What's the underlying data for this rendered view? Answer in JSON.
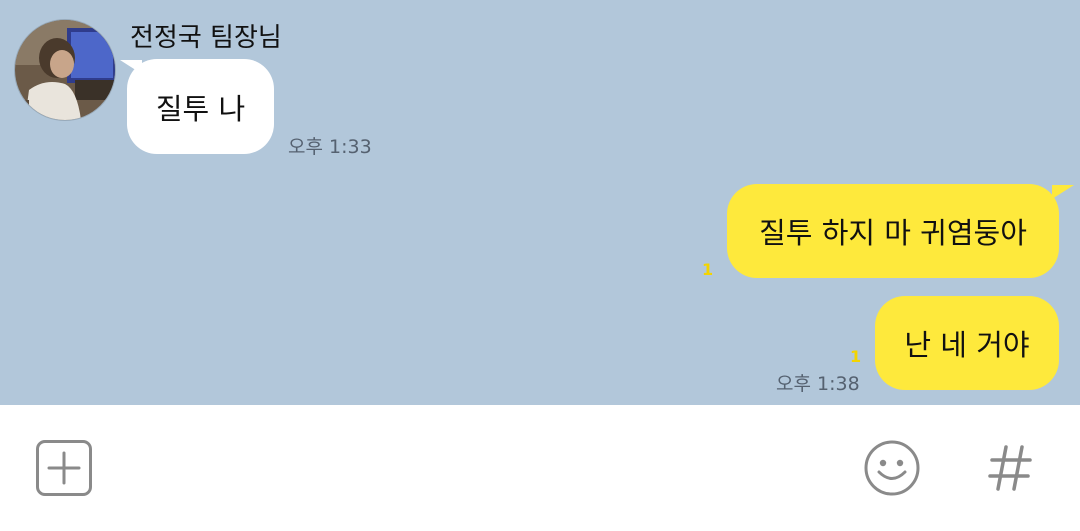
{
  "conversation": {
    "sender_name": "전정국 팀장님",
    "messages": [
      {
        "direction": "incoming",
        "text": "질투 나",
        "time": "오후 1:33"
      },
      {
        "direction": "outgoing",
        "text": "질투 하지 마 귀염둥아",
        "unread": "1"
      },
      {
        "direction": "outgoing",
        "text": "난 네 거야",
        "unread": "1",
        "time": "오후 1:38"
      }
    ]
  },
  "input_bar": {
    "icons": [
      "plus-icon",
      "emoji-icon",
      "hashtag-icon"
    ]
  },
  "colors": {
    "chat_background": "#b2c7da",
    "outgoing_bubble": "#fee93c",
    "incoming_bubble": "#ffffff",
    "unread_count": "#f3d400",
    "icon_gray": "#8a8a8a"
  }
}
